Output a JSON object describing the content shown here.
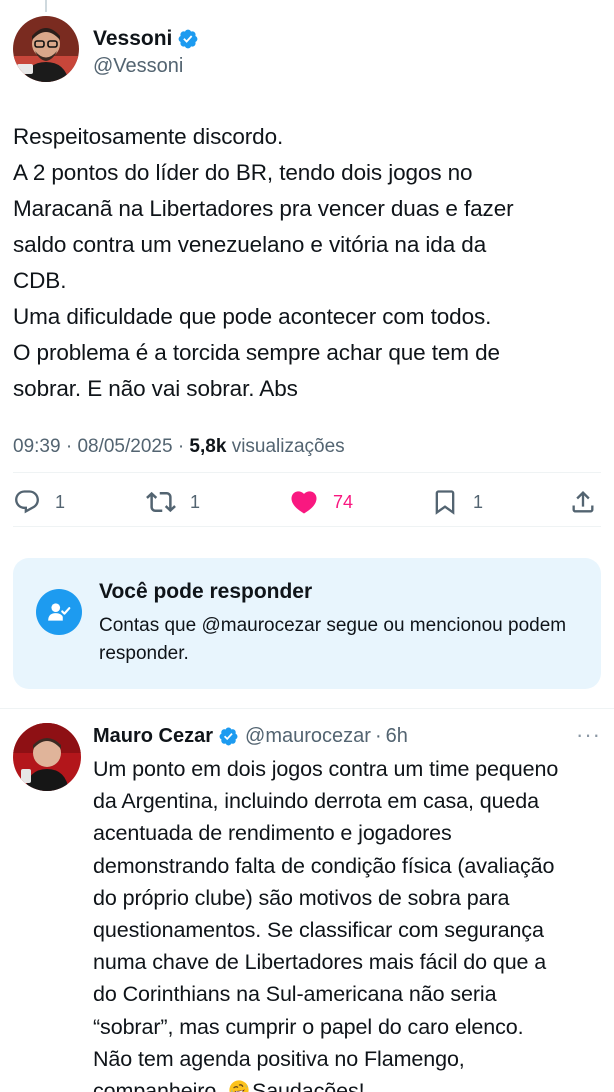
{
  "tweet": {
    "author": {
      "display_name": "Vessoni",
      "handle": "@Vessoni",
      "verified": true
    },
    "text_lines": [
      "Respeitosamente discordo.",
      "A 2 pontos do líder do BR, tendo dois jogos no",
      "Maracanã na Libertadores pra vencer duas e fazer",
      "saldo contra um venezuelano e vitória na ida da",
      "CDB.",
      "Uma dificuldade que pode acontecer com todos.",
      "O problema é a torcida sempre achar que tem de",
      "sobrar. E não vai sobrar. Abs"
    ],
    "time": "09:39",
    "date": "08/05/2025",
    "separator": "·",
    "views_count": "5,8k",
    "views_label": "visualizações",
    "actions": {
      "replies": "1",
      "reposts": "1",
      "likes": "74",
      "bookmarks": "1"
    }
  },
  "reply_permission": {
    "title": "Você pode responder",
    "description": "Contas que @maurocezar segue ou mencionou podem responder."
  },
  "reply": {
    "author": {
      "display_name": "Mauro Cezar",
      "handle": "@maurocezar",
      "verified": true
    },
    "separator": "·",
    "time": "6h",
    "more": "···",
    "text_lines": [
      "Um ponto em dois jogos contra um time pequeno",
      "da Argentina, incluindo derrota em casa, queda",
      "acentuada de rendimento e jogadores",
      "demonstrando falta de condição física (avaliação",
      "do próprio clube) são motivos de sobra para",
      "questionamentos. Se classificar com segurança",
      "numa chave de Libertadores mais fácil do que a",
      "do Corinthians na Sul-americana não seria",
      "“sobrar”, mas cumprir o papel do caro elenco.",
      "Não tem agenda positiva no Flamengo,"
    ],
    "last_line_prefix": "companheiro. ",
    "last_line_suffix": "Saudações!"
  },
  "colors": {
    "text_primary": "#0f1419",
    "text_secondary": "#536471",
    "verified_blue": "#1d9bf0",
    "like_pink": "#f91880",
    "reply_box_bg": "#e8f5fd"
  },
  "icons": {
    "verified": "verified-badge-icon",
    "reply": "reply-icon",
    "repost": "repost-icon",
    "like": "heart-icon",
    "bookmark": "bookmark-icon",
    "share": "share-icon",
    "reply_permission": "person-check-icon",
    "emoji": "rolling-laughing-emoji"
  }
}
